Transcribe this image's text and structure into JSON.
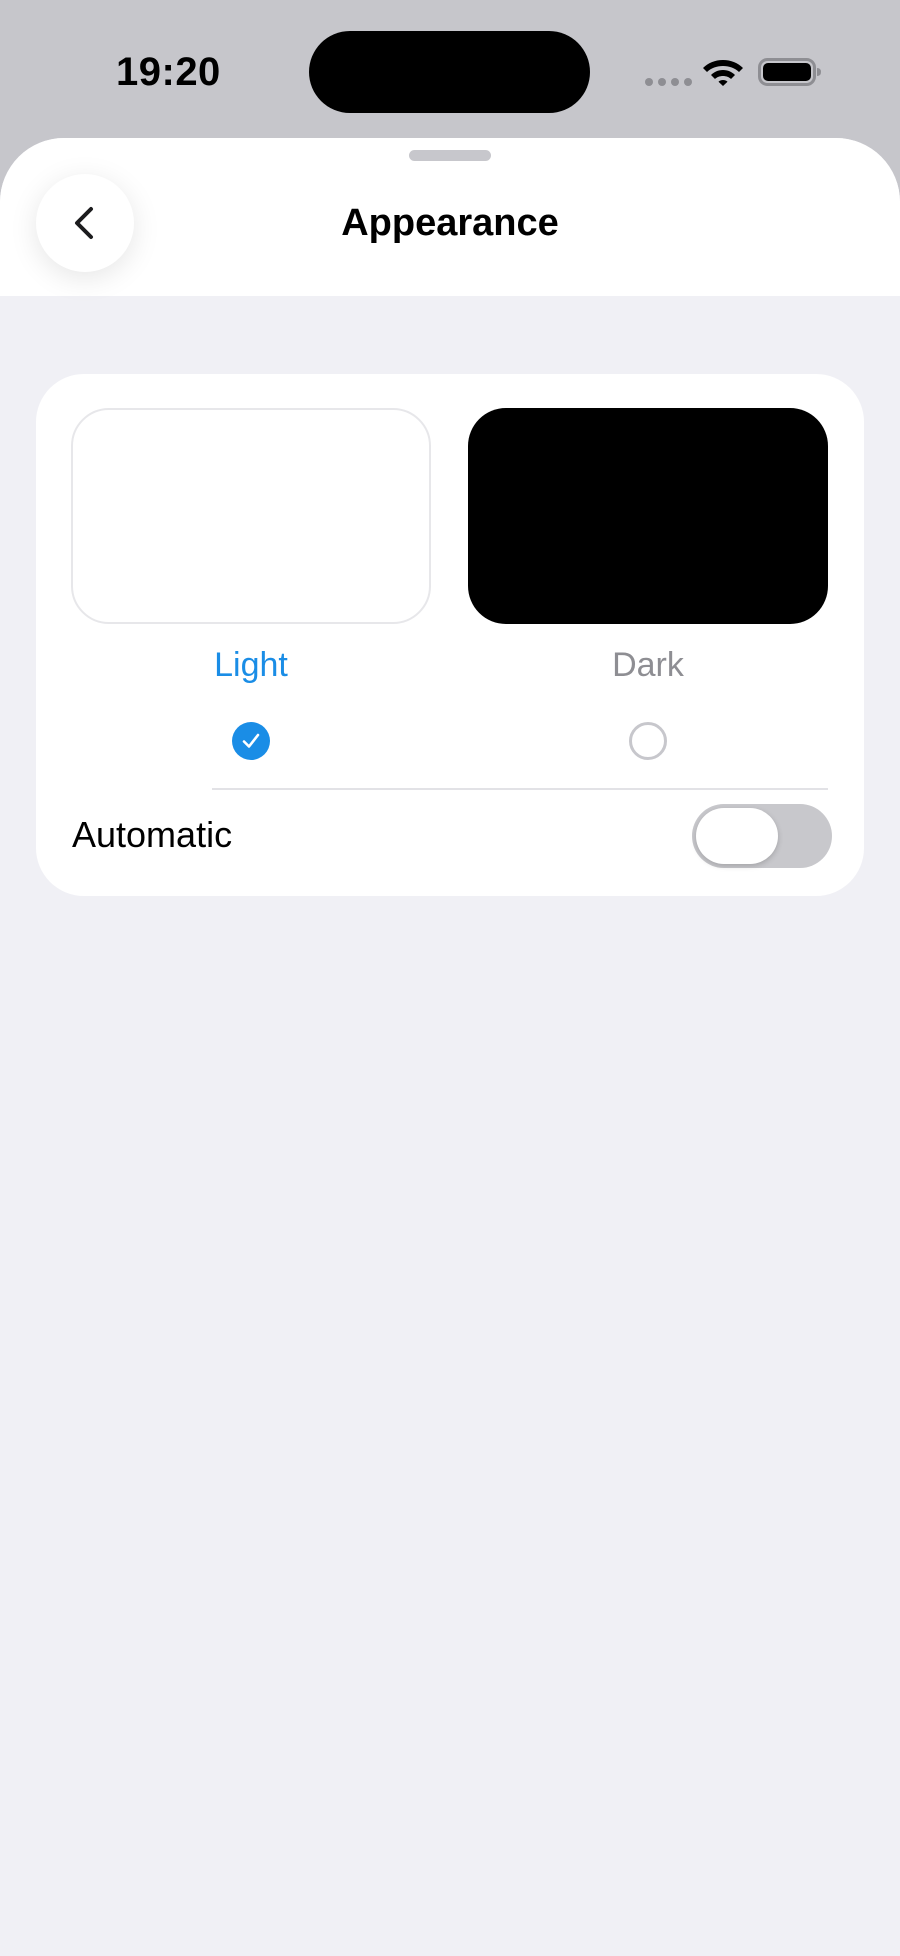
{
  "status_bar": {
    "time": "19:20",
    "icons": [
      "signal-dots-icon",
      "wifi-icon",
      "battery-icon"
    ]
  },
  "header": {
    "title": "Appearance",
    "back_icon": "chevron-left-icon"
  },
  "appearance": {
    "options": [
      {
        "label": "Light",
        "selected": true
      },
      {
        "label": "Dark",
        "selected": false
      }
    ],
    "automatic_label": "Automatic",
    "automatic_enabled": false
  },
  "colors": {
    "accent": "#1a8de6",
    "background": "#f0f0f5",
    "toggle_off": "#c8c8cc",
    "unselected_label": "#8e8e93"
  }
}
